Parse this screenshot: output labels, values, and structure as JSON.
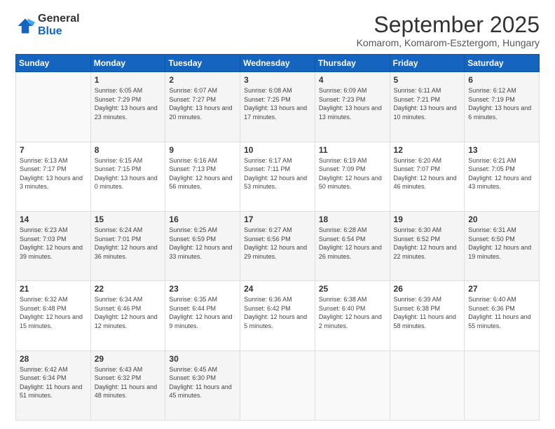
{
  "logo": {
    "general": "General",
    "blue": "Blue"
  },
  "title": "September 2025",
  "location": "Komarom, Komarom-Esztergom, Hungary",
  "days_of_week": [
    "Sunday",
    "Monday",
    "Tuesday",
    "Wednesday",
    "Thursday",
    "Friday",
    "Saturday"
  ],
  "weeks": [
    [
      {
        "day": "",
        "sunrise": "",
        "sunset": "",
        "daylight": ""
      },
      {
        "day": "1",
        "sunrise": "Sunrise: 6:05 AM",
        "sunset": "Sunset: 7:29 PM",
        "daylight": "Daylight: 13 hours and 23 minutes."
      },
      {
        "day": "2",
        "sunrise": "Sunrise: 6:07 AM",
        "sunset": "Sunset: 7:27 PM",
        "daylight": "Daylight: 13 hours and 20 minutes."
      },
      {
        "day": "3",
        "sunrise": "Sunrise: 6:08 AM",
        "sunset": "Sunset: 7:25 PM",
        "daylight": "Daylight: 13 hours and 17 minutes."
      },
      {
        "day": "4",
        "sunrise": "Sunrise: 6:09 AM",
        "sunset": "Sunset: 7:23 PM",
        "daylight": "Daylight: 13 hours and 13 minutes."
      },
      {
        "day": "5",
        "sunrise": "Sunrise: 6:11 AM",
        "sunset": "Sunset: 7:21 PM",
        "daylight": "Daylight: 13 hours and 10 minutes."
      },
      {
        "day": "6",
        "sunrise": "Sunrise: 6:12 AM",
        "sunset": "Sunset: 7:19 PM",
        "daylight": "Daylight: 13 hours and 6 minutes."
      }
    ],
    [
      {
        "day": "7",
        "sunrise": "Sunrise: 6:13 AM",
        "sunset": "Sunset: 7:17 PM",
        "daylight": "Daylight: 13 hours and 3 minutes."
      },
      {
        "day": "8",
        "sunrise": "Sunrise: 6:15 AM",
        "sunset": "Sunset: 7:15 PM",
        "daylight": "Daylight: 13 hours and 0 minutes."
      },
      {
        "day": "9",
        "sunrise": "Sunrise: 6:16 AM",
        "sunset": "Sunset: 7:13 PM",
        "daylight": "Daylight: 12 hours and 56 minutes."
      },
      {
        "day": "10",
        "sunrise": "Sunrise: 6:17 AM",
        "sunset": "Sunset: 7:11 PM",
        "daylight": "Daylight: 12 hours and 53 minutes."
      },
      {
        "day": "11",
        "sunrise": "Sunrise: 6:19 AM",
        "sunset": "Sunset: 7:09 PM",
        "daylight": "Daylight: 12 hours and 50 minutes."
      },
      {
        "day": "12",
        "sunrise": "Sunrise: 6:20 AM",
        "sunset": "Sunset: 7:07 PM",
        "daylight": "Daylight: 12 hours and 46 minutes."
      },
      {
        "day": "13",
        "sunrise": "Sunrise: 6:21 AM",
        "sunset": "Sunset: 7:05 PM",
        "daylight": "Daylight: 12 hours and 43 minutes."
      }
    ],
    [
      {
        "day": "14",
        "sunrise": "Sunrise: 6:23 AM",
        "sunset": "Sunset: 7:03 PM",
        "daylight": "Daylight: 12 hours and 39 minutes."
      },
      {
        "day": "15",
        "sunrise": "Sunrise: 6:24 AM",
        "sunset": "Sunset: 7:01 PM",
        "daylight": "Daylight: 12 hours and 36 minutes."
      },
      {
        "day": "16",
        "sunrise": "Sunrise: 6:25 AM",
        "sunset": "Sunset: 6:59 PM",
        "daylight": "Daylight: 12 hours and 33 minutes."
      },
      {
        "day": "17",
        "sunrise": "Sunrise: 6:27 AM",
        "sunset": "Sunset: 6:56 PM",
        "daylight": "Daylight: 12 hours and 29 minutes."
      },
      {
        "day": "18",
        "sunrise": "Sunrise: 6:28 AM",
        "sunset": "Sunset: 6:54 PM",
        "daylight": "Daylight: 12 hours and 26 minutes."
      },
      {
        "day": "19",
        "sunrise": "Sunrise: 6:30 AM",
        "sunset": "Sunset: 6:52 PM",
        "daylight": "Daylight: 12 hours and 22 minutes."
      },
      {
        "day": "20",
        "sunrise": "Sunrise: 6:31 AM",
        "sunset": "Sunset: 6:50 PM",
        "daylight": "Daylight: 12 hours and 19 minutes."
      }
    ],
    [
      {
        "day": "21",
        "sunrise": "Sunrise: 6:32 AM",
        "sunset": "Sunset: 6:48 PM",
        "daylight": "Daylight: 12 hours and 15 minutes."
      },
      {
        "day": "22",
        "sunrise": "Sunrise: 6:34 AM",
        "sunset": "Sunset: 6:46 PM",
        "daylight": "Daylight: 12 hours and 12 minutes."
      },
      {
        "day": "23",
        "sunrise": "Sunrise: 6:35 AM",
        "sunset": "Sunset: 6:44 PM",
        "daylight": "Daylight: 12 hours and 9 minutes."
      },
      {
        "day": "24",
        "sunrise": "Sunrise: 6:36 AM",
        "sunset": "Sunset: 6:42 PM",
        "daylight": "Daylight: 12 hours and 5 minutes."
      },
      {
        "day": "25",
        "sunrise": "Sunrise: 6:38 AM",
        "sunset": "Sunset: 6:40 PM",
        "daylight": "Daylight: 12 hours and 2 minutes."
      },
      {
        "day": "26",
        "sunrise": "Sunrise: 6:39 AM",
        "sunset": "Sunset: 6:38 PM",
        "daylight": "Daylight: 11 hours and 58 minutes."
      },
      {
        "day": "27",
        "sunrise": "Sunrise: 6:40 AM",
        "sunset": "Sunset: 6:36 PM",
        "daylight": "Daylight: 11 hours and 55 minutes."
      }
    ],
    [
      {
        "day": "28",
        "sunrise": "Sunrise: 6:42 AM",
        "sunset": "Sunset: 6:34 PM",
        "daylight": "Daylight: 11 hours and 51 minutes."
      },
      {
        "day": "29",
        "sunrise": "Sunrise: 6:43 AM",
        "sunset": "Sunset: 6:32 PM",
        "daylight": "Daylight: 11 hours and 48 minutes."
      },
      {
        "day": "30",
        "sunrise": "Sunrise: 6:45 AM",
        "sunset": "Sunset: 6:30 PM",
        "daylight": "Daylight: 11 hours and 45 minutes."
      },
      {
        "day": "",
        "sunrise": "",
        "sunset": "",
        "daylight": ""
      },
      {
        "day": "",
        "sunrise": "",
        "sunset": "",
        "daylight": ""
      },
      {
        "day": "",
        "sunrise": "",
        "sunset": "",
        "daylight": ""
      },
      {
        "day": "",
        "sunrise": "",
        "sunset": "",
        "daylight": ""
      }
    ]
  ]
}
